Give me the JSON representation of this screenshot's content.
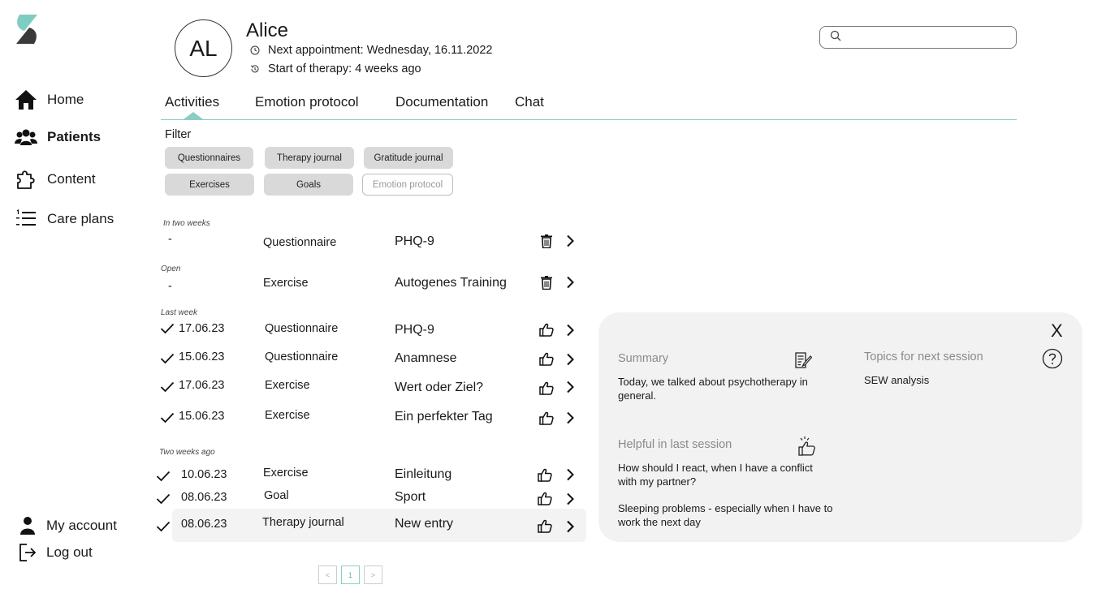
{
  "sidebar": {
    "items": [
      {
        "label": "Home",
        "icon": "home-icon"
      },
      {
        "label": "Patients",
        "icon": "patients-icon",
        "active": true
      },
      {
        "label": "Content",
        "icon": "puzzle-icon"
      },
      {
        "label": "Care plans",
        "icon": "list-icon"
      }
    ],
    "bottom": [
      {
        "label": "My account",
        "icon": "user-icon"
      },
      {
        "label": "Log out",
        "icon": "logout-icon"
      }
    ]
  },
  "patient": {
    "initials": "AL",
    "name": "Alice",
    "next_appointment": "Next appointment: Wednesday, 16.11.2022",
    "start_of_therapy": "Start of therapy: 4 weeks ago"
  },
  "search": {
    "placeholder": ""
  },
  "tabs": [
    "Activities",
    "Emotion protocol",
    "Documentation",
    "Chat"
  ],
  "filter": {
    "label": "Filter",
    "chips": [
      "Questionnaires",
      "Therapy journal",
      "Gratitude journal",
      "Exercises",
      "Goals",
      "Emotion protocol"
    ]
  },
  "groups": [
    "In two weeks",
    "Open",
    "Last week",
    "Two weeks ago"
  ],
  "rows": [
    {
      "status": "-",
      "date": "",
      "type": "Questionnaire",
      "title": "PHQ-9",
      "action": "trash-icon"
    },
    {
      "status": "-",
      "date": "",
      "type": "Exercise",
      "title": "Autogenes Training",
      "action": "trash-icon"
    },
    {
      "status": "check",
      "date": "17.06.23",
      "type": "Questionnaire",
      "title": "PHQ-9",
      "action": "thumbs-up-icon"
    },
    {
      "status": "check",
      "date": "15.06.23",
      "type": "Questionnaire",
      "title": "Anamnese",
      "action": "thumbs-up-icon"
    },
    {
      "status": "check",
      "date": "17.06.23",
      "type": "Exercise",
      "title": "Wert oder Ziel?",
      "action": "thumbs-up-icon"
    },
    {
      "status": "check",
      "date": "15.06.23",
      "type": "Exercise",
      "title": "Ein perfekter Tag",
      "action": "thumbs-up-icon"
    },
    {
      "status": "check",
      "date": "10.06.23",
      "type": "Exercise",
      "title": "Einleitung",
      "action": "thumbs-up-icon"
    },
    {
      "status": "check",
      "date": "08.06.23",
      "type": "Goal",
      "title": "Sport",
      "action": "thumbs-up-icon"
    },
    {
      "status": "check",
      "date": "08.06.23",
      "type": "Therapy journal",
      "title": "New entry",
      "action": "thumbs-up-icon"
    }
  ],
  "pagination": {
    "prev": "<",
    "current": "1",
    "next": ">"
  },
  "panel": {
    "close": "X",
    "summary_heading": "Summary",
    "summary_text": "Today, we talked about psychotherapy in general.",
    "topics_heading": "Topics for next session",
    "topics_text": "SEW analysis",
    "helpful_heading": "Helpful in last session",
    "helpful_items": [
      "How should I react, when I have a conflict with my partner?",
      "Sleeping problems - especially when I have to work the next day"
    ]
  },
  "colors": {
    "accent": "#8ccdc4",
    "chip": "#d9d9d9",
    "panel": "#f2f2f2",
    "logo_teal": "#7ecdc2",
    "logo_dark": "#3a3a3a"
  }
}
